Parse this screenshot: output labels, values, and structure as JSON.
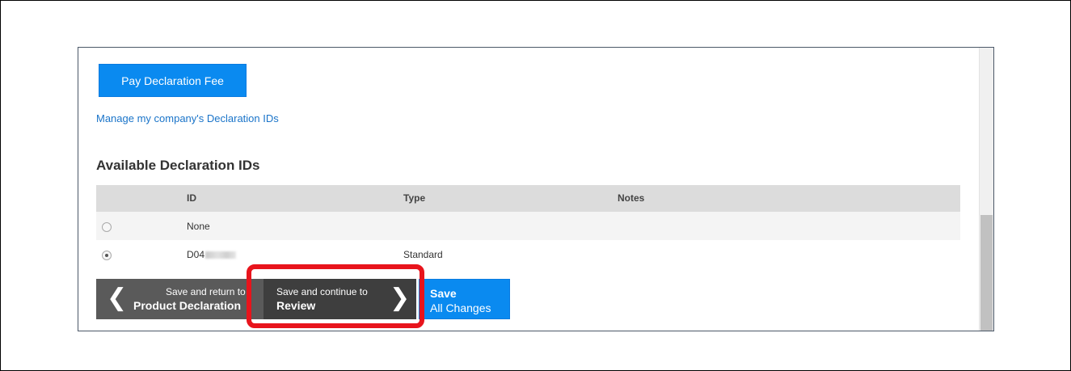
{
  "pay_button": {
    "label": "Pay Declaration Fee"
  },
  "manage_link": {
    "label": "Manage my company's Declaration IDs"
  },
  "section": {
    "title": "Available Declaration IDs"
  },
  "table": {
    "headers": {
      "id": "ID",
      "type": "Type",
      "notes": "Notes"
    },
    "rows": [
      {
        "id": "None",
        "type": "",
        "notes": "",
        "selected": false
      },
      {
        "id": "D04",
        "type": "Standard",
        "notes": "",
        "selected": true
      }
    ]
  },
  "footer": {
    "back": {
      "line1": "Save and return to",
      "line2": "Product Declaration"
    },
    "next": {
      "line1": "Save and continue to",
      "line2": "Review"
    },
    "save_all": {
      "line1": "Save",
      "line2": "All Changes"
    }
  },
  "icons": {
    "back": "chevron-left-icon",
    "next": "chevron-right-icon"
  },
  "colors": {
    "primary": "#0a8af0",
    "highlight": "#e8141c",
    "dark_button": "#3e3e3e"
  }
}
